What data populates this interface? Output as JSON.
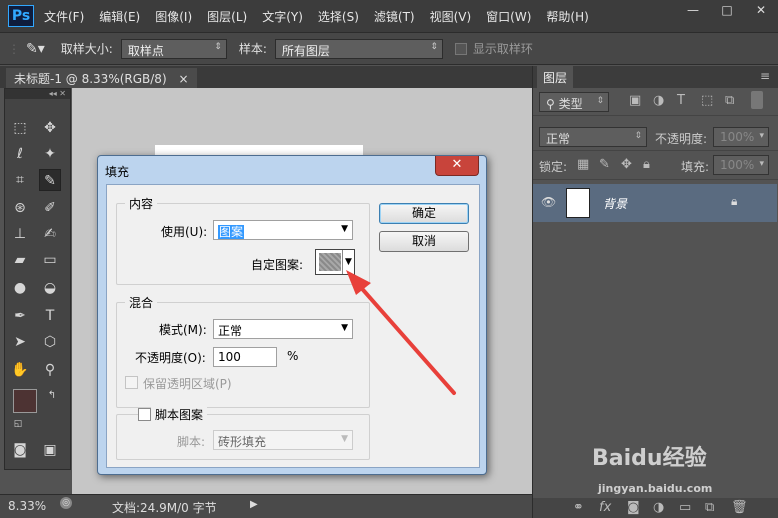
{
  "app": {
    "logo": "Ps"
  },
  "menubar": {
    "items": [
      "文件(F)",
      "编辑(E)",
      "图像(I)",
      "图层(L)",
      "文字(Y)",
      "选择(S)",
      "滤镜(T)",
      "视图(V)",
      "窗口(W)",
      "帮助(H)"
    ]
  },
  "window_controls": {
    "minimize": "—",
    "maximize": "□",
    "close": "✕"
  },
  "options": {
    "sample_size_label": "取样大小:",
    "sample_size_value": "取样点",
    "sample_label": "样本:",
    "sample_value": "所有图层",
    "show_ring_label": "显示取样环"
  },
  "document": {
    "tab_title": "未标题-1 @ 8.33%(RGB/8)",
    "tab_close": "×"
  },
  "status": {
    "zoom": "8.33%",
    "doc_info": "文档:24.9M/0 字节"
  },
  "layers_panel": {
    "tab": "图层",
    "filter_label": "类型",
    "blend_mode": "正常",
    "opacity_label": "不透明度:",
    "opacity_value": "100%",
    "lock_label": "锁定:",
    "fill_label": "填充:",
    "fill_value": "100%",
    "layers": [
      {
        "name": "背景",
        "locked": true
      }
    ]
  },
  "dialog": {
    "title": "填充",
    "close": "✕",
    "content_group": "内容",
    "use_label": "使用(U):",
    "use_value": "图案",
    "custom_pattern_label": "自定图案:",
    "blending_group": "混合",
    "mode_label": "模式(M):",
    "mode_value": "正常",
    "opacity_label": "不透明度(O):",
    "opacity_value": "100",
    "opacity_unit": "%",
    "preserve_transparency_label": "保留透明区域(P)",
    "script_pattern_label": "脚本图案",
    "script_label": "脚本:",
    "script_value": "砖形填充",
    "ok_button": "确定",
    "cancel_button": "取消"
  },
  "annotation": {
    "arrow_color": "#e8403a"
  },
  "colors": {
    "foreground": "#4d3333",
    "background": "#c9cfc0",
    "layer_selected": "#5a6b80"
  },
  "watermark": {
    "brand": "Baidu经验",
    "url": "jingyan.baidu.com"
  }
}
